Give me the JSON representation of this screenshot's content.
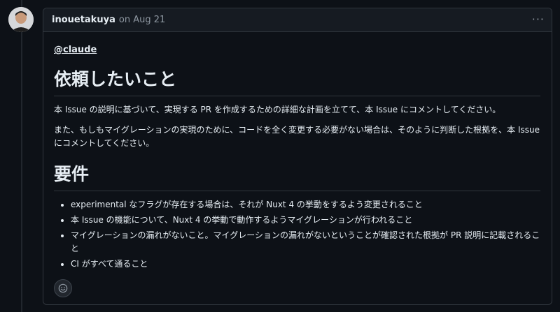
{
  "comment": {
    "author": "inouetakuya",
    "date_prefix": "on",
    "date": "Aug 21",
    "menu_icon": "kebab-horizontal-icon",
    "mention": "@claude",
    "heading1": "依頼したいこと",
    "para1": "本 Issue の説明に基づいて、実現する PR を作成するための詳細な計画を立てて、本 Issue にコメントしてください。",
    "para2": "また、もしもマイグレーションの実現のために、コードを全く変更する必要がない場合は、そのように判断した根拠を、本 Issue にコメントしてください。",
    "heading2": "要件",
    "requirements": [
      "experimental なフラグが存在する場合は、それが Nuxt 4 の挙動をするよう変更されること",
      "本 Issue の機能について、Nuxt 4 の挙動で動作するようマイグレーションが行われること",
      "マイグレーションの漏れがないこと。マイグレーションの漏れがないということが確認された根拠が PR 説明に記載されること",
      "CI がすべて通ること"
    ],
    "reaction_icon": "smiley-icon"
  }
}
